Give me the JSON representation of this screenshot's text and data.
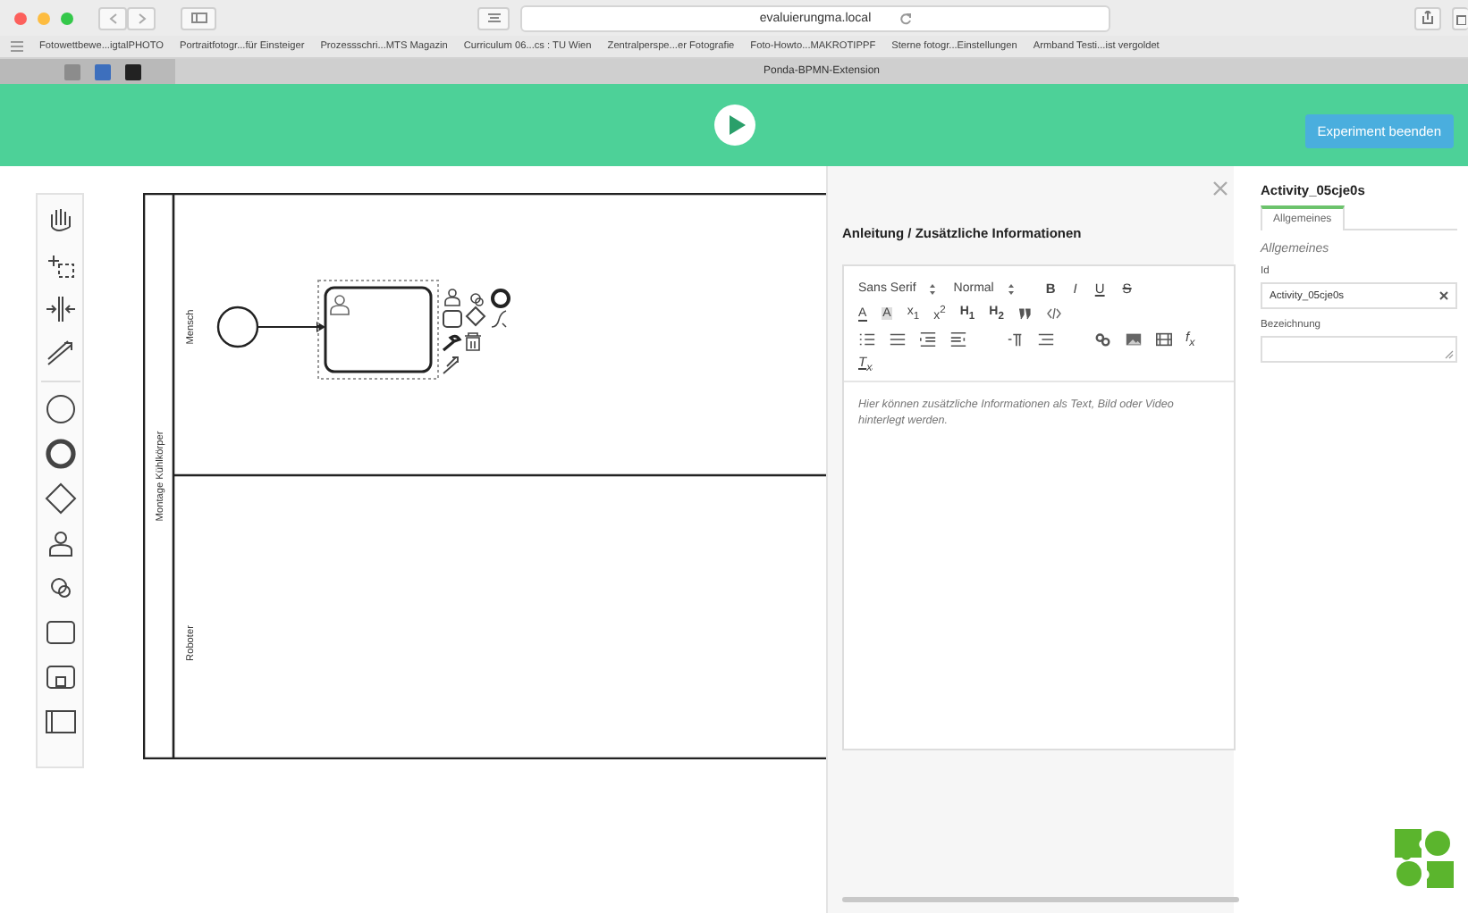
{
  "browser": {
    "url": "evaluierungma.local",
    "bookmarks": [
      "Fotowettbewe...igtalPHOTO",
      "Portraitfotogr...für Einsteiger",
      "Prozessschri...MTS Magazin",
      "Curriculum 06...cs : TU Wien",
      "Zentralperspe...er Fotografie",
      "Foto-Howto...MAKROTIPPF",
      "Sterne fotogr...Einstellungen",
      "Armband Testi...ist vergoldet"
    ],
    "tab_title": "Ponda-BPMN-Extension"
  },
  "header": {
    "button": "Experiment beenden"
  },
  "diagram": {
    "pool": "Montage Kühlkörper",
    "lanes": [
      {
        "name": "Mensch"
      },
      {
        "name": "Roboter"
      }
    ]
  },
  "instructions": {
    "title": "Anleitung / Zusätzliche Informationen",
    "fonts": [
      "Sans Serif",
      "Normal"
    ],
    "format_buttons": [
      "B",
      "I",
      "U",
      "S"
    ],
    "row2": [
      {
        "kind": "color",
        "label": "A"
      },
      {
        "kind": "background",
        "label": "A"
      },
      {
        "kind": "script",
        "label": "x$_{1}$"
      },
      {
        "kind": "script",
        "label": "x$^{2}$"
      },
      {
        "kind": "header",
        "label": "H$_{1}$"
      },
      {
        "kind": "header",
        "label": "H$_{2}$"
      }
    ],
    "formula": "f$_{x}$",
    "clear": "T$_{x}$",
    "content": "Hier können zusätzliche Informationen als Text, Bild oder Video hinterlegt werden."
  },
  "properties": {
    "title": "Activity_05cje0s",
    "tabs": [
      {
        "label": "Allgemeines",
        "selected": true
      }
    ],
    "section": "Allgemeines",
    "fields": [
      {
        "kind": "input",
        "label": "Id",
        "value": "Activity_05cje0s"
      },
      {
        "kind": "textarea",
        "label": "Bezeichnung"
      }
    ]
  }
}
